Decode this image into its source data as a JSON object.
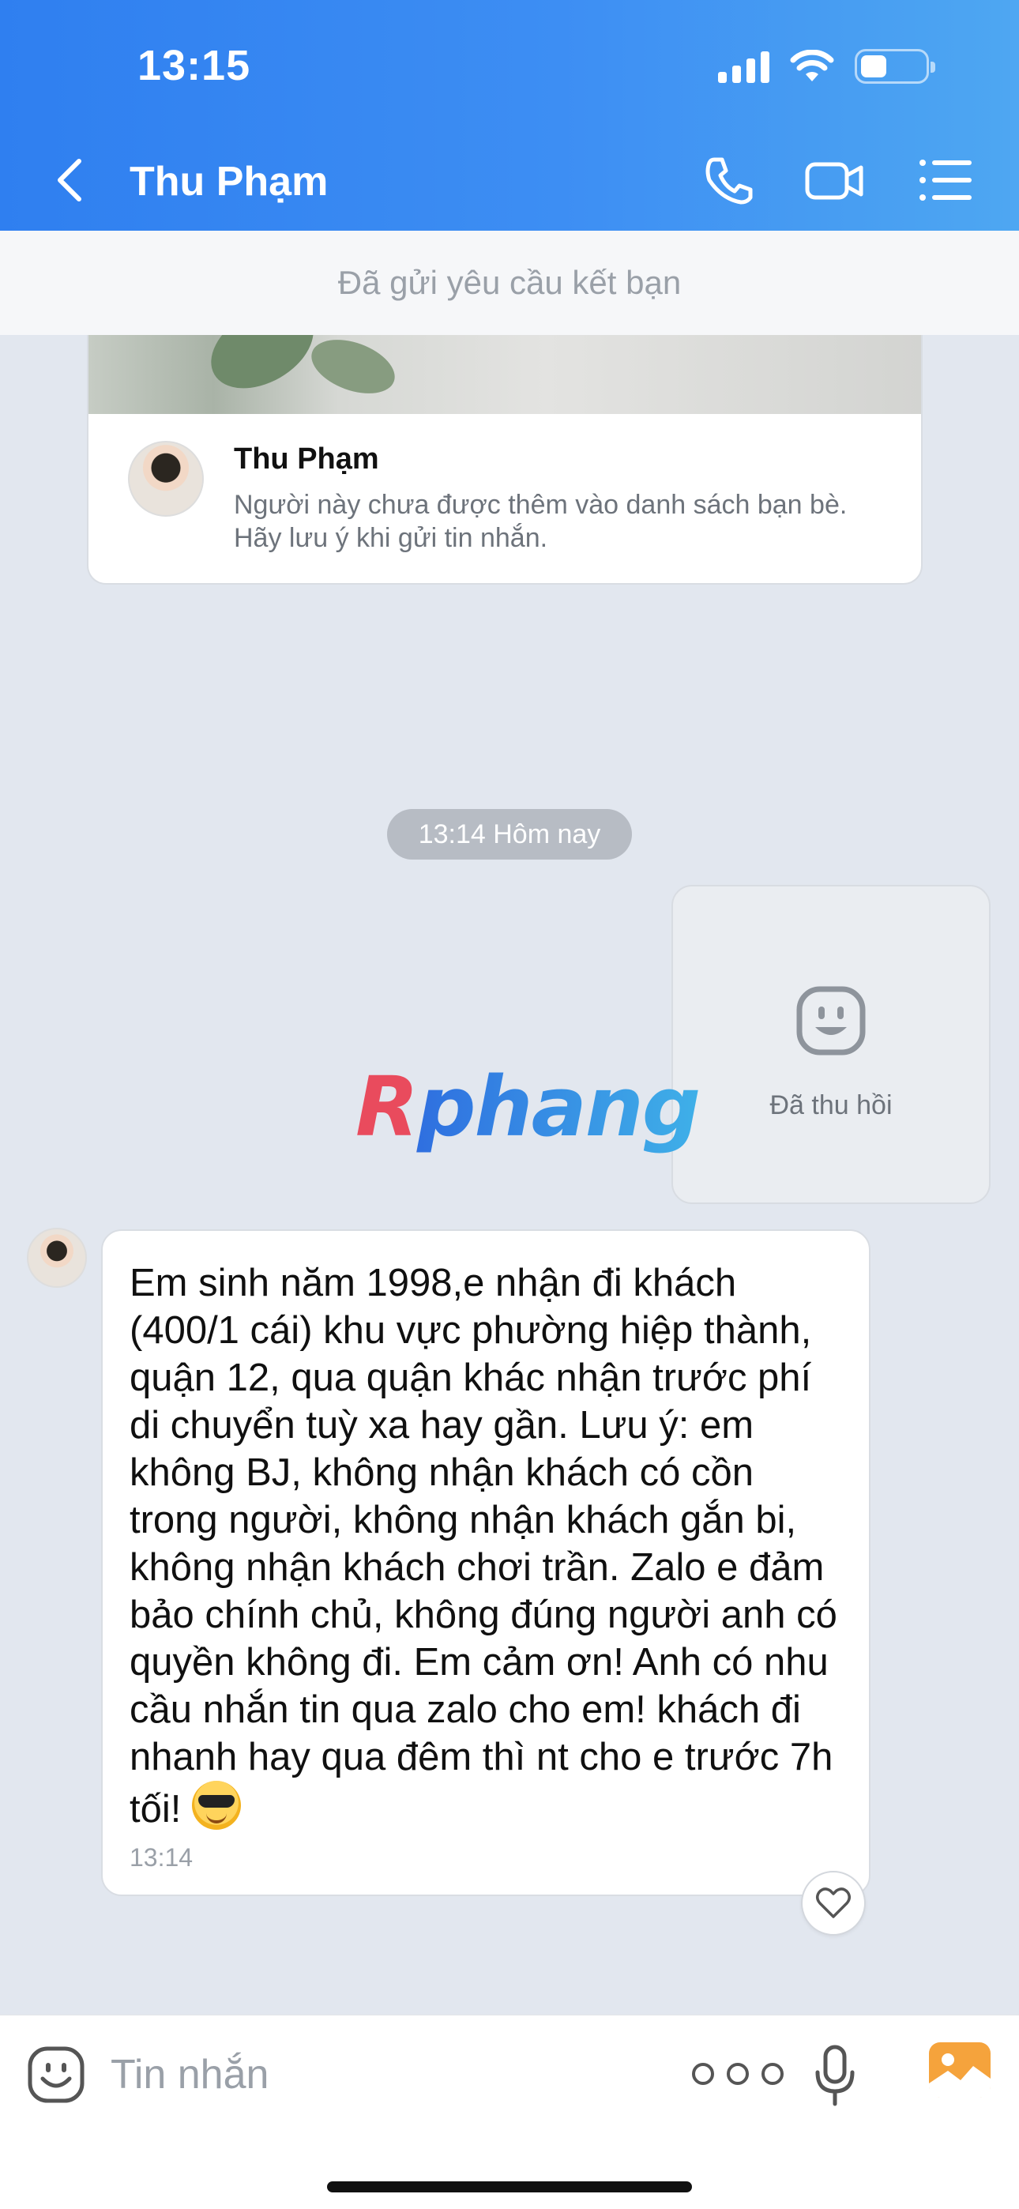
{
  "status_bar": {
    "time": "13:15"
  },
  "header": {
    "contact_name": "Thu Phạm"
  },
  "friend_request_bar": {
    "text": "Đã gửi yêu cầu kết bạn"
  },
  "profile_card": {
    "name": "Thu Phạm",
    "note": "Người này chưa được thêm vào danh sách bạn bè. Hãy lưu ý khi gửi tin nhắn."
  },
  "timestamp_pill": "13:14 Hôm nay",
  "recalled_message": {
    "text": "Đã thu hồi"
  },
  "watermark": "Rphang",
  "message": {
    "text": "Em sinh năm 1998,e nhận đi khách (400/1 cái) khu vực phường hiệp thành, quận 12, qua quận khác nhận trước phí di chuyển tuỳ xa hay gần. Lưu ý: em không BJ, không nhận khách có cồn trong người, không nhận khách gắn bi, không nhận khách chơi trần. Zalo e đảm bảo chính chủ, không đúng người anh có quyền không đi. Em cảm ơn! Anh có nhu cầu nhắn tin qua zalo cho em! khách đi nhanh hay qua đêm thì nt cho e trước 7h tối!",
    "emoji": "sunglasses-emoji",
    "time": "13:14"
  },
  "input_bar": {
    "placeholder": "Tin nhắn"
  },
  "colors": {
    "header_start": "#2f7ff0",
    "header_end": "#4ea7f2",
    "chat_bg": "#e2e7ef",
    "image_button": "#f5a33c"
  }
}
